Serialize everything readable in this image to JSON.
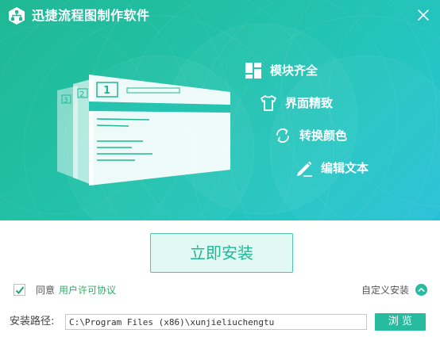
{
  "window": {
    "title": "迅捷流程图制作软件",
    "logo_icon": "flowchart-logo-icon",
    "close_icon": "close-icon"
  },
  "illustration": {
    "page_numbers": [
      "3",
      "2",
      "1"
    ]
  },
  "features": [
    {
      "label": "模块齐全",
      "icon": "module-grid-icon"
    },
    {
      "label": "界面精致",
      "icon": "tshirt-icon"
    },
    {
      "label": "转换颜色",
      "icon": "convert-arrows-icon"
    },
    {
      "label": "编辑文本",
      "icon": "pencil-icon"
    }
  ],
  "install": {
    "button_label": "立即安装"
  },
  "agreement": {
    "checked": true,
    "agree_text": "同意",
    "license_link": "用户许可协议"
  },
  "custom_install": {
    "label": "自定义安装",
    "toggle_icon": "chevron-up-circle-icon"
  },
  "path": {
    "label": "安装路径:",
    "value": "C:\\Program Files (x86)\\xunjieliuchengtu",
    "browse_label": "浏 览"
  },
  "colors": {
    "accent": "#27bba0",
    "hero_start": "#1fb894",
    "hero_end": "#28c0d8",
    "install_text": "#1eb896",
    "link": "#3aa86a"
  }
}
